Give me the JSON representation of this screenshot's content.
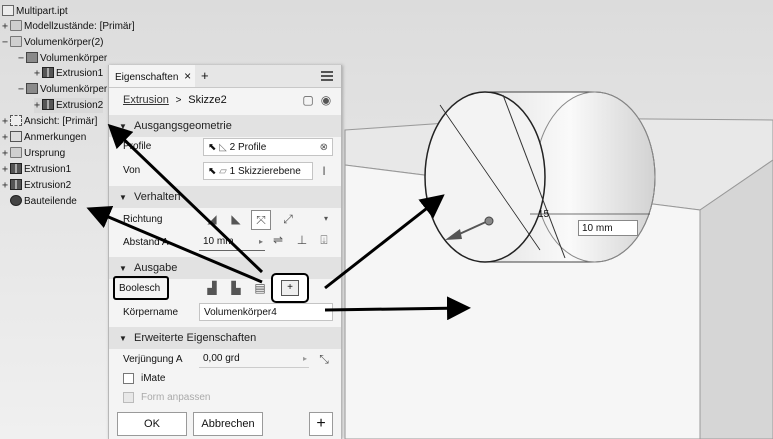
{
  "tree": {
    "root": "Multipart.ipt",
    "items": [
      {
        "label": "Modellzustände: [Primär]"
      },
      {
        "label": "Volumenkörper(2)"
      },
      {
        "label": "Volumenkörper"
      },
      {
        "label": "Extrusion1"
      },
      {
        "label": "Volumenkörper"
      },
      {
        "label": "Extrusion2"
      },
      {
        "label": "Ansicht: [Primär]"
      },
      {
        "label": "Anmerkungen"
      },
      {
        "label": "Ursprung"
      },
      {
        "label": "Extrusion1"
      },
      {
        "label": "Extrusion2"
      },
      {
        "label": "Bauteilende"
      }
    ]
  },
  "panel": {
    "tab_title": "Eigenschaften",
    "tab_close": "×",
    "tab_add": "+",
    "breadcrumb": {
      "extrusion": "Extrusion",
      "separator": ">",
      "sketch": "Skizze2"
    },
    "section_input": "Ausgangsgeometrie",
    "profile_label": "Profile",
    "profile_value": "2 Profile",
    "from_label": "Von",
    "from_value": "1 Skizzierebene",
    "section_behavior": "Verhalten",
    "direction_label": "Richtung",
    "distance_label": "Abstand A",
    "distance_value": "10 mm",
    "section_output": "Ausgabe",
    "boolean_label": "Boolesch",
    "body_label": "Körpername",
    "body_value": "Volumenkörper4",
    "section_advanced": "Erweiterte Eigenschaften",
    "taper_label": "Verjüngung A",
    "taper_value": "0,00 grd",
    "imate_label": "iMate",
    "match_shape_label": "Form anpassen",
    "ok_label": "OK",
    "cancel_label": "Abbrechen",
    "plus_label": "+"
  },
  "model": {
    "dim_diameter": "15",
    "dim_length": "10 mm"
  }
}
